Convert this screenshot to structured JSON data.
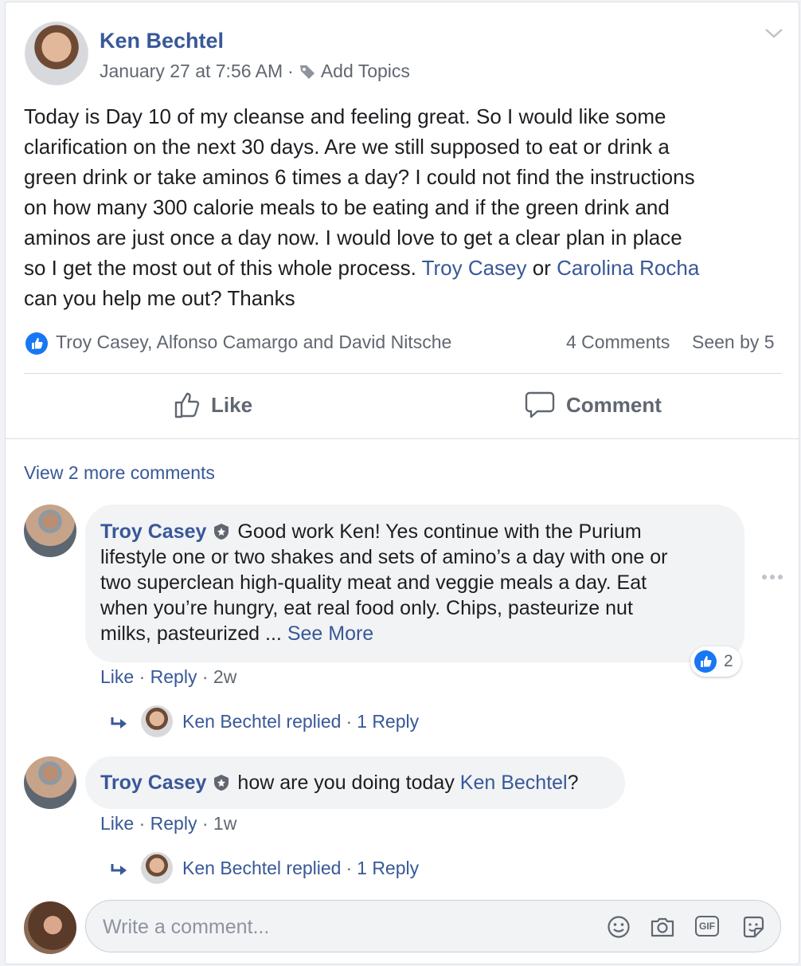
{
  "post": {
    "author": "Ken Bechtel",
    "timestamp": "January 27 at 7:56 AM",
    "separator": "·",
    "add_topics": "Add Topics",
    "body_lines": [
      "Today is Day 10 of my cleanse and feeling great. So I would like some",
      "clarification on the next 30 days. Are we still supposed to eat or drink a",
      "green drink or take aminos 6 times a day? I could not find the instructions",
      "on how many 300 calorie meals to be eating and if the green drink and",
      "aminos are just once a day now. I would love to get a clear plan in place"
    ],
    "body_line6_text": "so I get the most out of this whole process. ",
    "mention1": "Troy Casey",
    "or_text": " or ",
    "mention2": "Carolina Rocha",
    "body_line7": "can you help me out? Thanks",
    "reactions_names": "Troy Casey, Alfonso Camargo and David Nitsche",
    "comments_count": "4 Comments",
    "seen_by": "Seen by 5",
    "like_label": "Like",
    "comment_label": "Comment"
  },
  "comments": {
    "view_more": "View 2 more comments",
    "c1": {
      "author": "Troy Casey",
      "line1": "Good work Ken! Yes continue with the Purium",
      "line2": "lifestyle one or two shakes and sets of amino’s a day with one or",
      "line3": "two superclean high-quality meat and veggie meals a day. Eat",
      "line4": "when you’re hungry, eat real food only. Chips, pasteurize nut",
      "line5": "milks, pasteurized ... ",
      "see_more": "See More",
      "like": "Like",
      "dot": " · ",
      "reply": "Reply",
      "time": "2w",
      "reaction_count": "2",
      "replied_text": "Ken Bechtel replied",
      "reply_count": "1 Reply"
    },
    "c2": {
      "author": "Troy Casey",
      "text": "how are you doing today ",
      "mention": "Ken Bechtel",
      "end": "?",
      "like": "Like",
      "dot": " · ",
      "reply": "Reply",
      "time": "1w",
      "replied_text": "Ken Bechtel replied",
      "reply_count": "1 Reply"
    },
    "input_placeholder": "Write a comment...",
    "input_icons": [
      "emoji-icon",
      "camera-icon",
      "gif-icon",
      "sticker-icon"
    ],
    "gif_label": "GIF"
  },
  "colors": {
    "link": "#385898",
    "like_blue": "#1877f2",
    "text": "#1c1e21",
    "meta": "#606770"
  }
}
